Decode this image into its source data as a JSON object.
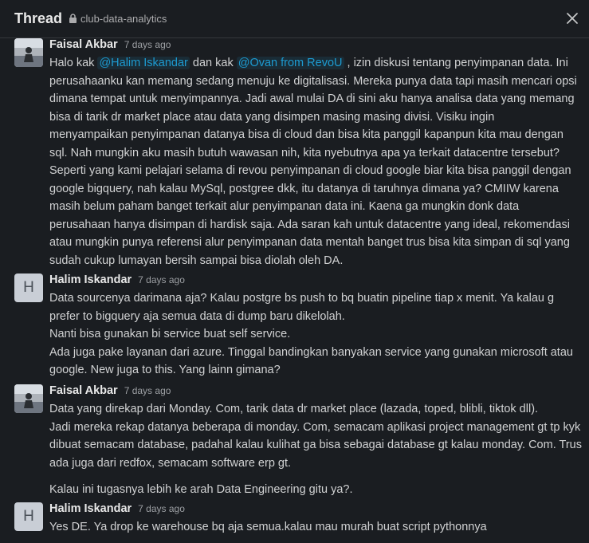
{
  "header": {
    "title": "Thread",
    "channel": "club-data-analytics"
  },
  "messages": [
    {
      "author": "Faisal Akbar",
      "time": "7 days ago",
      "first_line": {
        "pre": "Halo kak",
        "mention1": "@Halim Iskandar",
        "mid": "dan kak",
        "mention2": "@Ovan from RevoU",
        "post": ", izin diskusi tentang penyimpanan data. Ini"
      },
      "lines": [
        "perusahaanku kan memang sedang menuju ke digitalisasi. Mereka punya data tapi masih mencari opsi",
        "dimana tempat untuk menyimpannya. Jadi awal mulai DA di sini aku hanya analisa data yang memang",
        "bisa di tarik dr market place atau data yang disimpen masing masing divisi. Visiku ingin",
        "menyampaikan penyimpanan datanya bisa di cloud dan bisa kita panggil kapanpun kita mau dengan",
        "sql. Nah mungkin aku masih butuh wawasan nih, kita nyebutnya apa ya terkait datacentre tersebut?",
        "Seperti yang kami pelajari selama di revou penyimpanan di cloud google biar kita bisa panggil dengan",
        "google bigquery, nah kalau MySql, postgree dkk, itu datanya di taruhnya dimana ya? CMIIW karena",
        "masih belum paham banget terkait alur penyimpanan data ini. Kaena ga mungkin donk data",
        "perusahaan hanya disimpan di hardisk saja. Ada saran kah untuk datacentre yang ideal, rekomendasi",
        "atau mungkin punya referensi alur penyimpanan data mentah banget trus bisa kita simpan di sql yang",
        "sudah cukup lumayan bersih sampai bisa diolah oleh DA."
      ]
    },
    {
      "author": "Halim Iskandar",
      "avatar_letter": "H",
      "time": "7 days ago",
      "lines": [
        "Data sourcenya darimana aja? Kalau postgre bs push to bq buatin pipeline tiap x menit. Ya kalau g",
        "prefer to bigquery aja semua data di dump baru dikelolah.",
        "Nanti bisa gunakan bi service buat self service.",
        "Ada juga pake layanan dari azure. Tinggal bandingkan banyakan service yang gunakan microsoft atau",
        "google. New juga to this. Yang lainn gimana?"
      ]
    },
    {
      "author": "Faisal Akbar",
      "time": "7 days ago",
      "lines": [
        "Data yang direkap dari Monday. Com, tarik data dr market place (lazada, toped, blibli, tiktok dll).",
        "Jadi mereka rekap datanya beberapa di monday. Com, semacam aplikasi project management gt tp kyk",
        "dibuat semacam database, padahal kalau kulihat ga bisa sebagai database gt kalau monday. Com. Trus",
        "ada juga dari redfox, semacam software erp gt."
      ],
      "extra_line": "Kalau ini tugasnya lebih ke arah Data Engineering gitu ya?."
    },
    {
      "author": "Halim Iskandar",
      "avatar_letter": "H",
      "time": "7 days ago",
      "lines": [
        "Yes DE. Ya drop ke warehouse bq aja semua.kalau mau murah buat script pythonnya"
      ]
    }
  ],
  "icons": {
    "lock": "lock-icon",
    "close": "close-icon"
  },
  "colors": {
    "background": "#1a1d21",
    "mention": "#1d9bd1",
    "text": "#d1d2d3"
  }
}
